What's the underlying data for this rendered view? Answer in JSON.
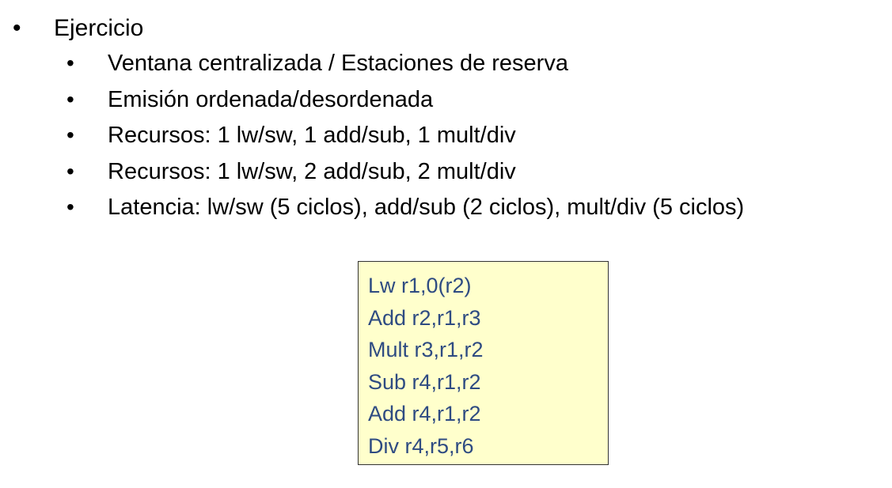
{
  "main_bullet": {
    "bullet": "•",
    "text": "Ejercicio"
  },
  "sub_bullets": [
    {
      "bullet": "•",
      "text": "Ventana centralizada / Estaciones de reserva"
    },
    {
      "bullet": "•",
      "text": "Emisión ordenada/desordenada"
    },
    {
      "bullet": "•",
      "text": "Recursos: 1 lw/sw, 1 add/sub, 1 mult/div"
    },
    {
      "bullet": "•",
      "text": "Recursos: 1 lw/sw, 2 add/sub, 2 mult/div"
    },
    {
      "bullet": "•",
      "text": "Latencia: lw/sw (5 ciclos), add/sub (2 ciclos), mult/div (5 ciclos)"
    }
  ],
  "code_box": {
    "lines": [
      "Lw r1,0(r2)",
      "Add r2,r1,r3",
      "Mult r3,r1,r2",
      "Sub r4,r1,r2",
      "Add r4,r1,r2",
      "Div r4,r5,r6"
    ]
  },
  "colors": {
    "code_text": "#2e4b82",
    "code_background": "#ffffcc",
    "code_border": "#333333",
    "body_text": "#000000"
  }
}
